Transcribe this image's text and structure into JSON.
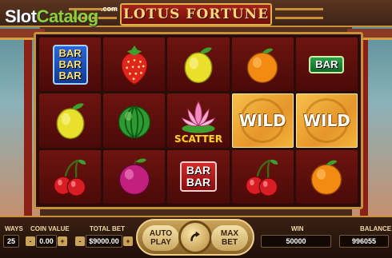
{
  "brand": {
    "main": "Slot",
    "accent": "Catalog",
    "suffix": ".com"
  },
  "game": {
    "title": "LOTUS FORTUNE"
  },
  "reels": {
    "row1": [
      "BAR BAR BAR",
      "strawberry",
      "lemon",
      "orange",
      "BAR"
    ],
    "row2": [
      "lemon",
      "watermelon",
      "SCATTER",
      "WILD",
      "WILD"
    ],
    "row3": [
      "cherry",
      "plum",
      "BAR BAR",
      "cherry",
      "orange"
    ]
  },
  "symbols": {
    "bar_line": "BAR",
    "wild": "WILD",
    "scatter": "SCATTER"
  },
  "controls": {
    "ways_label": "WAYS",
    "ways_value": "25",
    "coin_label": "COIN VALUE",
    "coin_value": "0.00",
    "total_label": "TOTAL BET",
    "total_value": "$9000.00",
    "auto_line1": "AUTO",
    "auto_line2": "PLAY",
    "max_line1": "MAX",
    "max_line2": "BET",
    "win_label": "WIN",
    "win_value": "50000",
    "balance_label": "BALANCE",
    "balance_value": "996055",
    "minus": "-",
    "plus": "+"
  },
  "colors": {
    "frame_gold": "#c89038",
    "reel_red": "#6e1410",
    "wild_gold": "#f2b33a"
  }
}
